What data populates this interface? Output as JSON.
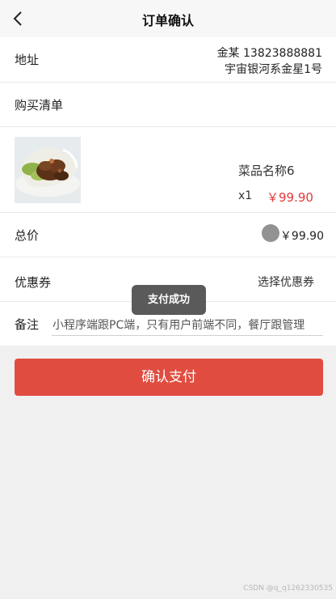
{
  "navbar": {
    "title": "订单确认",
    "back_icon": "chevron-left-icon"
  },
  "address": {
    "label": "地址",
    "name_phone": "金某 13823888881",
    "detail": "宇宙银河系金星1号"
  },
  "purchase_list": {
    "label": "购买清单"
  },
  "item": {
    "name": "菜品名称6",
    "quantity": "x1",
    "price": "￥99.90"
  },
  "total": {
    "label": "总价",
    "value": "￥99.90"
  },
  "coupon": {
    "label": "优惠券",
    "select_text": "选择优惠券"
  },
  "note": {
    "label": "备注",
    "value": "小程序端跟PC端，只有用户前端不同，餐厅跟管理"
  },
  "toast": {
    "message": "支付成功"
  },
  "pay_button": {
    "label": "确认支付"
  },
  "watermark": "CSDN @q_q1262330535",
  "colors": {
    "accent": "#e04d40",
    "price": "#e03a3a",
    "toast_bg": "#4c4c4c"
  }
}
